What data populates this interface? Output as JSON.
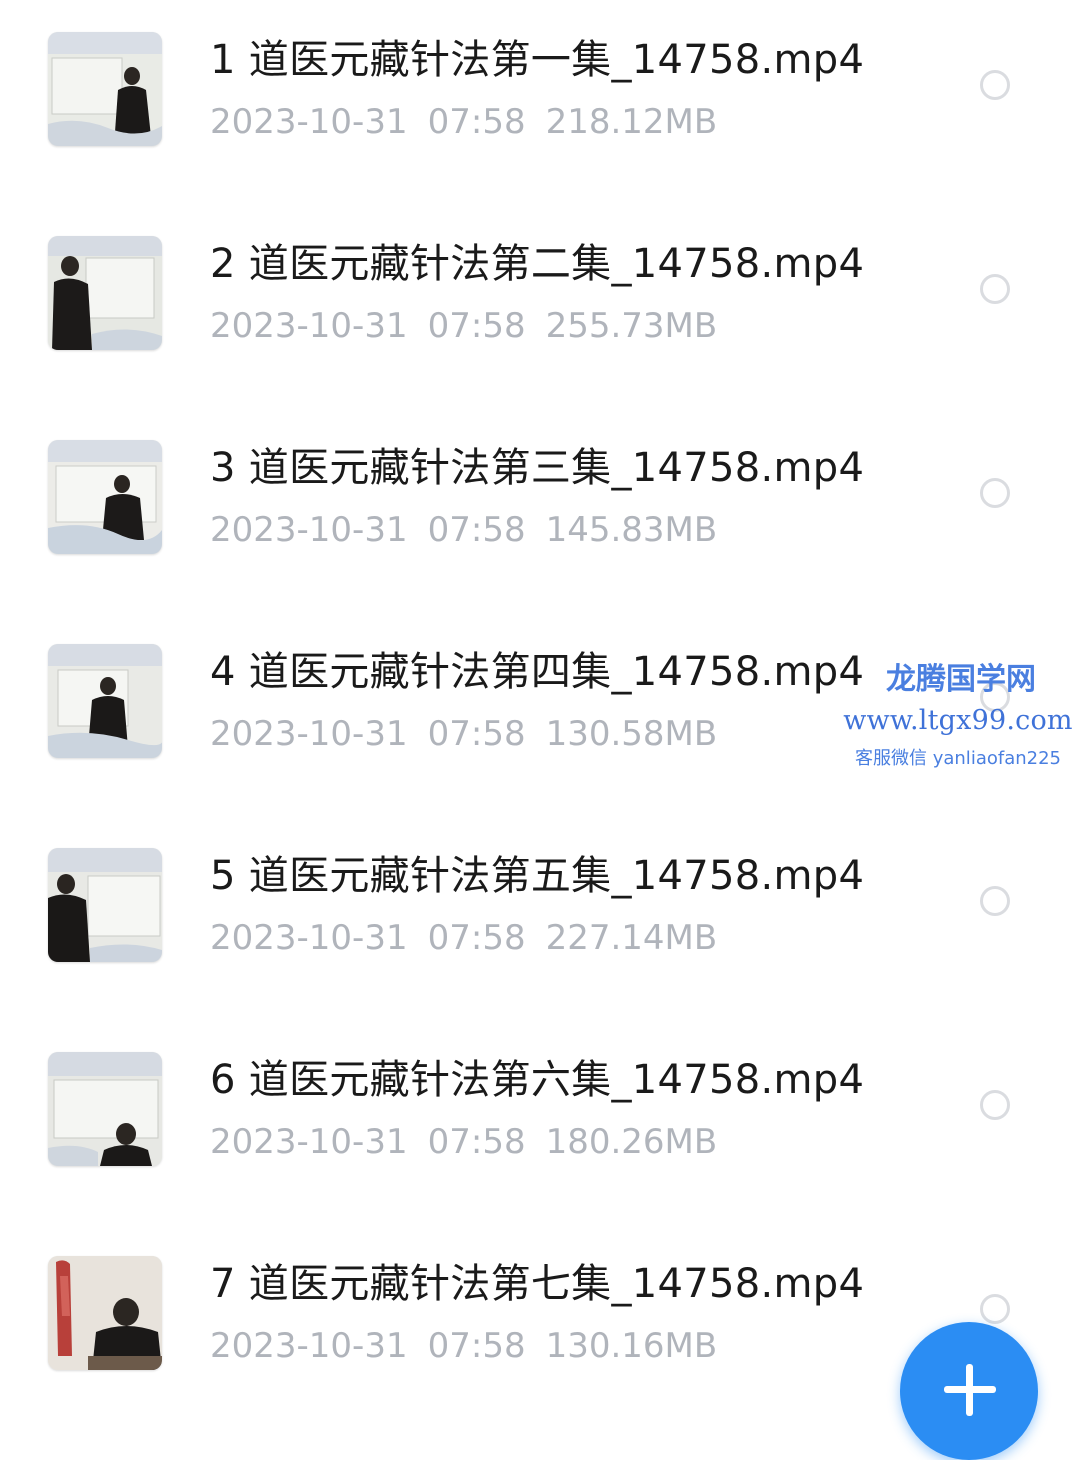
{
  "files": [
    {
      "name": "1 道医元藏针法第一集_14758.mp4",
      "date": "2023-10-31",
      "time": "07:58",
      "size": "218.12MB"
    },
    {
      "name": "2 道医元藏针法第二集_14758.mp4",
      "date": "2023-10-31",
      "time": "07:58",
      "size": "255.73MB"
    },
    {
      "name": "3 道医元藏针法第三集_14758.mp4",
      "date": "2023-10-31",
      "time": "07:58",
      "size": "145.83MB"
    },
    {
      "name": "4 道医元藏针法第四集_14758.mp4",
      "date": "2023-10-31",
      "time": "07:58",
      "size": "130.58MB"
    },
    {
      "name": "5 道医元藏针法第五集_14758.mp4",
      "date": "2023-10-31",
      "time": "07:58",
      "size": "227.14MB"
    },
    {
      "name": "6 道医元藏针法第六集_14758.mp4",
      "date": "2023-10-31",
      "time": "07:58",
      "size": "180.26MB"
    },
    {
      "name": "7 道医元藏针法第七集_14758.mp4",
      "date": "2023-10-31",
      "time": "07:58",
      "size": "130.16MB"
    }
  ],
  "watermark": {
    "title": "龙腾国学网",
    "url": "www.ltgx99.com",
    "contact": "客服微信 yanliaofan225"
  },
  "fab": {
    "icon": "plus-icon"
  },
  "colors": {
    "accent": "#2b8df3",
    "meta_text": "#b0b4bb",
    "name_text": "#1a1a1a",
    "watermark": "#4a7fe0"
  }
}
